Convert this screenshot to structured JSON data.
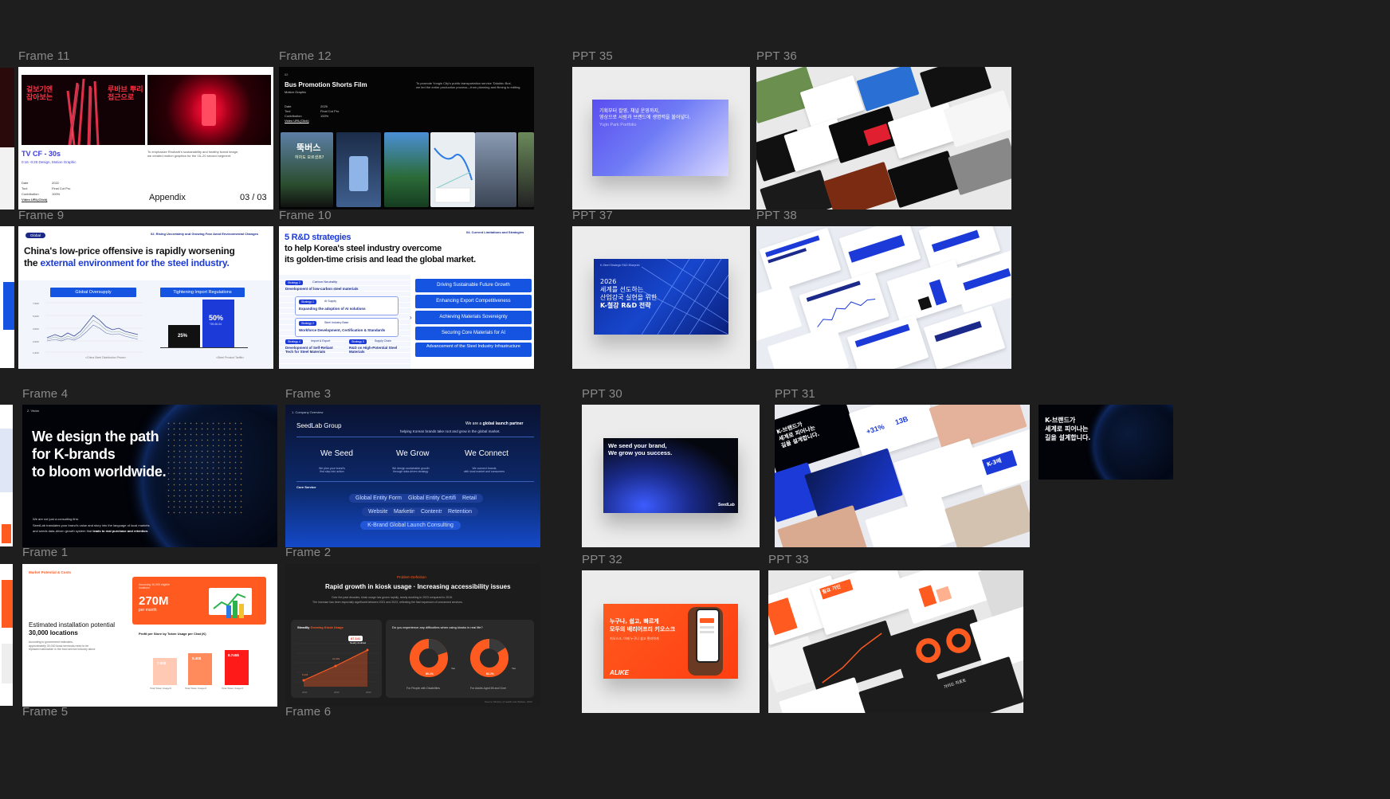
{
  "labels": {
    "f11": "Frame 11",
    "f12": "Frame 12",
    "p35": "PPT 35",
    "p36": "PPT 36",
    "f9": "Frame 9",
    "f10": "Frame 10",
    "p37": "PPT 37",
    "p38": "PPT 38",
    "f4": "Frame 4",
    "f3": "Frame 3",
    "p30": "PPT 30",
    "p31": "PPT 31",
    "f1": "Frame 1",
    "f2": "Frame 2",
    "p32": "PPT 32",
    "p33": "PPT 33",
    "f5": "Frame 5",
    "f6": "Frame 6"
  },
  "frame11": {
    "kr_left": "겉보기엔\n잡아보는",
    "kr_right": "루바브 뿌리\n접근으로",
    "title": "TV CF - 30s",
    "subtitle": "0:16 -0:20 Design, Motion Graphic",
    "desc": "To emphasize Rhubarb's sustainability and healthy brand image,\nwe created motion graphics for the 16–20 second segment.",
    "meta_keys": [
      "Date",
      "Tool",
      "Contribution",
      "Video URL(Click)"
    ],
    "meta_vals": [
      "2022",
      "Final Cut Pro",
      "100%",
      ""
    ],
    "appendix": "Appendix",
    "page": "03 / 03"
  },
  "frame12": {
    "num": "02",
    "title": "Bus Promotion Shorts Film",
    "sub": "Motion Graphic",
    "desc": "To promote Yongin City's public transportation service 'Ddukbu Bus',\nwe led the entire production process—from planning and filming to editing.",
    "meta_keys": [
      "Date",
      "Tool",
      "Contribution",
      "Video URL(Click)"
    ],
    "meta_vals": [
      "2025",
      "Final Cut Pro",
      "100%",
      ""
    ],
    "kr_big": "뚝버스",
    "kr_q": "하차도 모르셨죠?"
  },
  "ppt35": {
    "line1": "기획부터 촬영, 채널 운영까지,",
    "line2": "영상으로 사람과 브랜드에 생명력을 불어넣다.",
    "line3": "Yujin Park Portfolio"
  },
  "frame9": {
    "badge": "Global",
    "section": "02. Rising Uncertainty and Growing Fear Amid Environmental Changes",
    "title1": "China's low-price offensive is rapidly worsening",
    "title2a": "the ",
    "title2b": "external environment for the steel industry.",
    "chart1": "Global Oversupply",
    "chart2": "Tightening Import Regulations",
    "bar1": "25%",
    "bar2": "50%",
    "bar2sub": "*25.06.04",
    "cap1": "<China Steel Distribution Prices>",
    "cap2": "<Steel Product Tariffs>",
    "yticks": [
      "7,000",
      "6,500",
      "6,000",
      "5,500",
      "5,000",
      "4,500",
      "4,000",
      "3,500",
      "3,000",
      "2,500",
      "2,000",
      "1,500",
      "1,000"
    ]
  },
  "frame10": {
    "title1": "5 R&D strategies",
    "title2": "to help Korea's steel industry overcome",
    "title3": "its golden-time crisis and lead the global market.",
    "section": "04. Current Limitations and Strategies",
    "s2tag": "Strategy 2",
    "s2label": "Carbon Neutrality",
    "s2text": "Development of low-carbon steel materials",
    "s1tag": "Strategy 1",
    "s1label": "AI Supply",
    "s1text": "Expanding the adoption of AI solutions",
    "s3tag": "Strategy 2",
    "s3label": "Steel Industry Base",
    "s3text": "Workforce Development, Certification & Standards",
    "s4tag": "Strategy 4",
    "s4label": "Import & Export",
    "s4text": "Development of Self-Reliant Tech for Steel Materials",
    "s5tag": "Strategy 5",
    "s5label": "Supply Chain",
    "s5text": "R&D on High-Potential Steel Materials",
    "goals": [
      "Driving Sustainable Future Growth",
      "Enhancing Export Competitiveness",
      "Achieving Materials Sovereignty",
      "Securing Core Materials for AI",
      "Advancement of the Steel Industry Infrastructure"
    ]
  },
  "ppt37": {
    "top": "K-Steel Strategic R&D Blueprint",
    "line1": "2026",
    "line2": "세계를 선도하는",
    "line3": "산업강국 실현을 위한",
    "line4": "K-철강 R&D 전략"
  },
  "frame4": {
    "num": "2. Vision",
    "line1": "We design the path",
    "line2": "for K-brands",
    "line3": "to bloom worldwide.",
    "p1": "We are not just a consulting firm.",
    "p2": "SeedLab translates your brand's value and story into the language of local markets",
    "p3a": "and seeds data-driven growth system that ",
    "p3b": "leads to real purchase and retention."
  },
  "frame3": {
    "num": "1. Company Overview",
    "brand": "SeedLab Group",
    "tag1a": "We are a ",
    "tag1b": "global launch partner",
    "tag2": "helping Korean brands take root and grow in the global market.",
    "cols": [
      "We Seed",
      "We Grow",
      "We Connect"
    ],
    "colsub": [
      "We plan your brand's\nfirst step into action",
      "We design sustainable growth\nthrough data-driven strategy",
      "We connect brands\nwith local market and consumers"
    ],
    "core": "Core Service",
    "pills1": [
      "Global Entity Formation",
      "Global Entity Certification",
      "Retail"
    ],
    "pills2": [
      "Website",
      "Marketing",
      "Contents",
      "Retention"
    ],
    "pill3": "K-Brand Global Launch Consulting"
  },
  "ppt30": {
    "line1": "We seed your brand,",
    "line2": "We grow you success.",
    "logo": "SeedLab"
  },
  "ppt31": {
    "kr1": "K-브랜드가",
    "kr2": "세계로 피어나는",
    "kr3": "길을 설계합니다.",
    "stat1": "+31%",
    "stat2": "13B",
    "big": "K-3배",
    "custom": "Custom / H-Mart\nAmazon / Emallion"
  },
  "ppt31b": {
    "kr1": "K-브랜드가",
    "kr2": "세계로 피어나는",
    "kr3": "길을 설계합니다."
  },
  "frame1": {
    "section": "Market Potential & Costs",
    "headline1": "Estimated installation potential",
    "headline2": "30,000 locations",
    "desc": "According to government estimates,\napproximately 30,000 kiosk terminals need to be\nreplaced nationwide in the food service industry alone.",
    "card_small": "Assuming 30,000 eligible\nlocations",
    "card_big": "270M",
    "card_unit": "per month",
    "chart_title": "Profit per Store by Token Usage per Chat (K)",
    "bars": [
      "7.00$",
      "8.40$",
      "8.745$"
    ],
    "bar_labels": [
      "Total Token Usage①",
      "Total Token Usage②",
      "Total Token Usage③"
    ]
  },
  "frame2": {
    "tag": "Problem Definition",
    "title": "Rapid growth in kiosk usage · Increasing accessibility issues",
    "desc1": "Over the past decades, kiosk usage has grown rapidly, nearly doubling in 2023 compared to 2015.",
    "desc2": "The increase has been especially significant between 2021 and 2023, reflecting the fast expansion of unmanned services.",
    "left_title_a": "Steadily ",
    "left_title_b": "Growing Kiosk Usage",
    "callout": "87,141",
    "callout_sub": "Nearly doubled",
    "pts": [
      "5,131",
      "21,601"
    ],
    "years": [
      "2021",
      "2022",
      "2023"
    ],
    "right_title": "Do you experience any difficulties when using kiosks in real life?",
    "d1": "80.1%",
    "d2": "84.2%",
    "d1cap": "For People with Disabilities",
    "d2cap": "For Adults Aged 65 and Over",
    "yes": "Yes",
    "source": "Source: Ministry of Health and Welfare, 2023"
  },
  "ppt32": {
    "line1": "누구나, 쉽고, 빠르게",
    "line2": "모두의 배리어프리 키오스크",
    "sub": "키오스크, 이제 누구나 쉽고 편리하게",
    "logo": "ALIKE"
  },
  "ppt33": {
    "kr": "필요 기인",
    "kr2": "가이드 리포트"
  },
  "colors": {
    "bg": "#1e1e1e",
    "label": "#8a8a8a",
    "blue": "#1554e0",
    "navy": "#0a1a5c",
    "orange": "#ff5a1f",
    "red": "#e01b1b",
    "purple": "#6b5cff"
  }
}
